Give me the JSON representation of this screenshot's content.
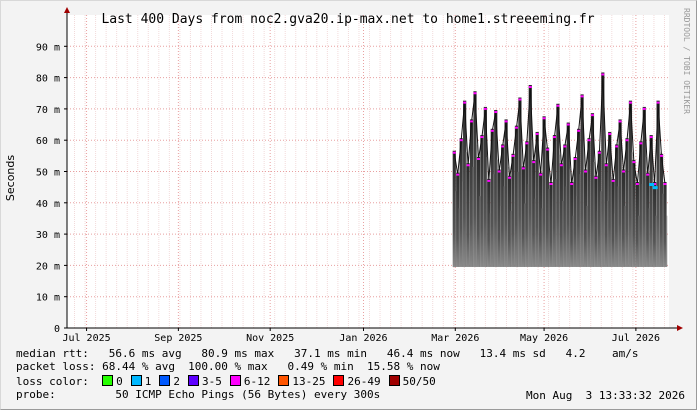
{
  "chart_data": {
    "type": "line",
    "title": "Last 400 Days from noc2.gva20.ip-max.net to home1.streeeming.fr",
    "ylabel": "Seconds",
    "watermark": "RRDTOOL / TOBI OETIKER",
    "y_ticks": [
      {
        "value": 0,
        "label": "0"
      },
      {
        "value": 0.01,
        "label": "10 m"
      },
      {
        "value": 0.02,
        "label": "20 m"
      },
      {
        "value": 0.03,
        "label": "30 m"
      },
      {
        "value": 0.04,
        "label": "40 m"
      },
      {
        "value": 0.05,
        "label": "50 m"
      },
      {
        "value": 0.06,
        "label": "60 m"
      },
      {
        "value": 0.07,
        "label": "70 m"
      },
      {
        "value": 0.08,
        "label": "80 m"
      },
      {
        "value": 0.09,
        "label": "90 m"
      }
    ],
    "ylim": [
      0,
      0.1
    ],
    "x_ticks": [
      "Jul 2025",
      "Sep 2025",
      "Nov 2025",
      "Jan 2026",
      "Mar 2026",
      "May 2026",
      "Jul 2026"
    ],
    "x_range_days": 400,
    "data_start_day": 256,
    "grid": true,
    "series": [
      {
        "name": "median rtt",
        "type": "median",
        "values": [
          0.056,
          0.049,
          0.06,
          0.072,
          0.052,
          0.066,
          0.075,
          0.054,
          0.061,
          0.07,
          0.047,
          0.063,
          0.069,
          0.05,
          0.058,
          0.066,
          0.048,
          0.055,
          0.064,
          0.073,
          0.051,
          0.059,
          0.077,
          0.053,
          0.062,
          0.049,
          0.067,
          0.057,
          0.046,
          0.061,
          0.071,
          0.052,
          0.058,
          0.065,
          0.046,
          0.054,
          0.063,
          0.074,
          0.05,
          0.06,
          0.068,
          0.048,
          0.056,
          0.081,
          0.052,
          0.062,
          0.047,
          0.058,
          0.066,
          0.05,
          0.06,
          0.072,
          0.053,
          0.046,
          0.059,
          0.07,
          0.049,
          0.061,
          0.046,
          0.072,
          0.055,
          0.046
        ]
      },
      {
        "name": "min rtt",
        "type": "smoke-floor",
        "values": [
          0.0195,
          0.0205,
          0.019,
          0.02,
          0.0198,
          0.0202
        ]
      }
    ],
    "loss_markers": [
      {
        "index": 57,
        "value": 0.046,
        "color": "#00bbff"
      },
      {
        "index": 58,
        "value": 0.045,
        "color": "#00bbff"
      }
    ]
  },
  "legend": {
    "median_line": "median rtt:   56.6 ms avg   80.9 ms max   37.1 ms min   46.4 ms now   13.4 ms sd   4.2    am/s",
    "loss_line": "packet loss: 68.44 % avg  100.00 % max   0.49 % min  15.58 % now",
    "loss_color_label": "loss color:",
    "loss_colors": [
      {
        "label": "0",
        "color": "#26ff00"
      },
      {
        "label": "1",
        "color": "#00b8ff"
      },
      {
        "label": "2",
        "color": "#0059ff"
      },
      {
        "label": "3-5",
        "color": "#5e00ff"
      },
      {
        "label": "6-12",
        "color": "#ff00ff"
      },
      {
        "label": "13-25",
        "color": "#ff5500"
      },
      {
        "label": "26-49",
        "color": "#ff0000"
      },
      {
        "label": "50/50",
        "color": "#a00000"
      }
    ],
    "probe_line": "probe:         50 ICMP Echo Pings (56 Bytes) every 300s",
    "timestamp": "Mon Aug  3 13:33:32 2026"
  }
}
